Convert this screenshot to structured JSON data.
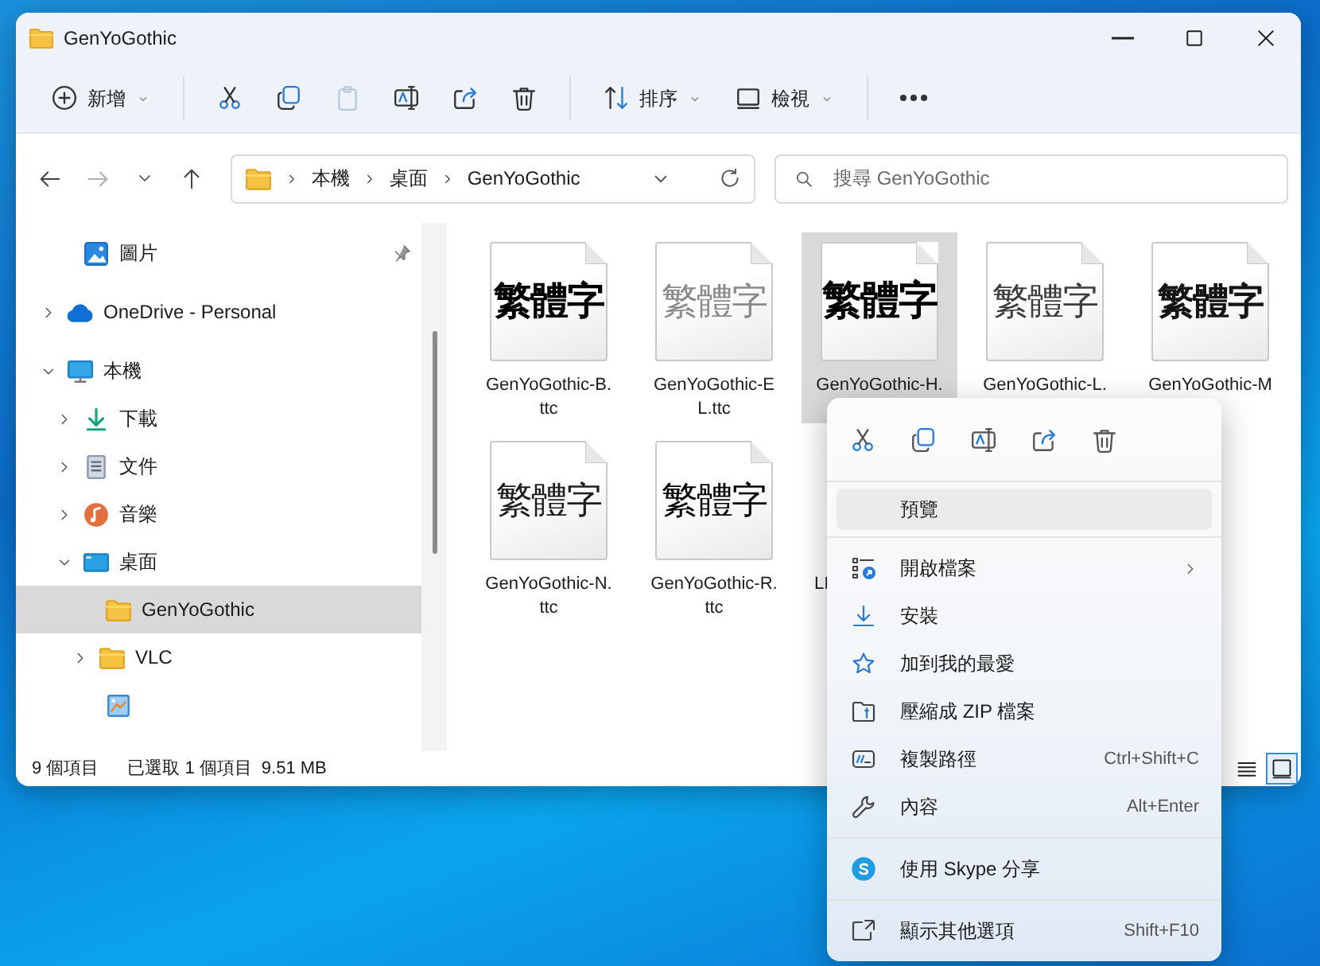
{
  "window": {
    "title": "GenYoGothic"
  },
  "command_bar": {
    "groups": [
      {
        "items": [
          {
            "kind": "new",
            "label": "新增",
            "dropdown": true,
            "disabled": false
          }
        ]
      },
      {
        "items": [
          {
            "kind": "cut",
            "dropdown": false,
            "disabled": false
          },
          {
            "kind": "copy",
            "dropdown": false,
            "disabled": false
          },
          {
            "kind": "paste",
            "dropdown": false,
            "disabled": true
          },
          {
            "kind": "rename",
            "dropdown": false,
            "disabled": false
          },
          {
            "kind": "share",
            "dropdown": false,
            "disabled": false
          },
          {
            "kind": "delete",
            "dropdown": false,
            "disabled": false
          }
        ]
      },
      {
        "items": [
          {
            "kind": "sort",
            "label": "排序",
            "dropdown": true,
            "disabled": false
          },
          {
            "kind": "view",
            "label": "檢視",
            "dropdown": true,
            "disabled": false
          }
        ]
      },
      {
        "items": [
          {
            "kind": "more",
            "dropdown": false,
            "disabled": false
          }
        ]
      }
    ]
  },
  "navigation": {
    "buttons": [
      {
        "kind": "back",
        "disabled": false
      },
      {
        "kind": "forward",
        "disabled": true
      },
      {
        "kind": "recent",
        "disabled": false
      },
      {
        "kind": "up",
        "disabled": false
      }
    ]
  },
  "address_bar": {
    "segments": [
      "本機",
      "桌面",
      "GenYoGothic"
    ]
  },
  "search": {
    "placeholder": "搜尋 GenYoGothic"
  },
  "sidebar": {
    "items": [
      {
        "kind": "pictures",
        "label": "圖片",
        "pinned": true,
        "selected": false
      },
      {
        "kind": "cloud",
        "label": "OneDrive - Personal",
        "pinned": false,
        "expanded": false,
        "selected": false
      },
      {
        "kind": "pc",
        "label": "本機",
        "pinned": false,
        "expanded": true,
        "selected": false,
        "children": [
          {
            "kind": "download",
            "label": "下載",
            "expanded": false,
            "selected": false
          },
          {
            "kind": "documents",
            "label": "文件",
            "expanded": false,
            "selected": false
          },
          {
            "kind": "music",
            "label": "音樂",
            "expanded": false,
            "selected": false
          },
          {
            "kind": "desktop",
            "label": "桌面",
            "expanded": true,
            "selected": false,
            "children": [
              {
                "kind": "folder",
                "label": "GenYoGothic",
                "selected": true
              },
              {
                "kind": "folder",
                "label": "VLC",
                "expanded": false,
                "selected": false
              },
              {
                "kind": "app",
                "selected": false
              }
            ]
          }
        ]
      }
    ]
  },
  "files": [
    {
      "name": "GenYoGothic-B.ttc",
      "preview_text": "繁體字",
      "kind": "bold",
      "selected": false
    },
    {
      "name": "GenYoGothic-EL.ttc",
      "preview_text": "繁體字",
      "kind": "extralight",
      "selected": false
    },
    {
      "name": "GenYoGothic-H.",
      "preview_text": "繁體字",
      "kind": "heavy",
      "selected": true
    },
    {
      "name": "GenYoGothic-L.",
      "preview_text": "繁體字",
      "kind": "light",
      "selected": false
    },
    {
      "name": "GenYoGothic-M",
      "preview_text": "繁體字",
      "kind": "medium",
      "selected": false
    },
    {
      "name": "GenYoGothic-N.ttc",
      "preview_text": "繁體字",
      "kind": "normal",
      "selected": false
    },
    {
      "name": "GenYoGothic-R.ttc",
      "preview_text": "繁體字",
      "kind": "regular",
      "selected": false
    },
    {
      "name": "LI",
      "kind": "other"
    }
  ],
  "status_bar": {
    "item_count": "9 個項目",
    "selection": "已選取 1 個項目",
    "size": "9.51 MB"
  },
  "view_buttons": [
    {
      "kind": "details",
      "selected": false
    },
    {
      "kind": "large_icons",
      "selected": true
    }
  ],
  "context_menu": {
    "quick_actions": [
      {
        "kind": "cut"
      },
      {
        "kind": "copy"
      },
      {
        "kind": "rename"
      },
      {
        "kind": "share"
      },
      {
        "kind": "delete"
      }
    ],
    "groups": [
      {
        "items": [
          {
            "label": "預覽",
            "highlighted": true,
            "submenu": false
          }
        ]
      },
      {
        "items": [
          {
            "kind": "open",
            "label": "開啟檔案",
            "highlighted": false,
            "submenu": true
          },
          {
            "kind": "install",
            "label": "安裝",
            "highlighted": false,
            "submenu": false
          },
          {
            "kind": "star",
            "label": "加到我的最愛",
            "highlighted": false,
            "submenu": false
          },
          {
            "kind": "zip",
            "label": "壓縮成 ZIP 檔案",
            "highlighted": false,
            "submenu": false
          },
          {
            "kind": "path",
            "label": "複製路徑",
            "shortcut": "Ctrl+Shift+C",
            "highlighted": false,
            "submenu": false
          },
          {
            "kind": "wrench",
            "label": "內容",
            "shortcut": "Alt+Enter",
            "highlighted": false,
            "submenu": false
          }
        ]
      },
      {
        "items": [
          {
            "kind": "skype",
            "label": "使用 Skype 分享",
            "highlighted": false,
            "submenu": false
          }
        ]
      },
      {
        "items": [
          {
            "kind": "more_options",
            "label": "顯示其他選項",
            "shortcut": "Shift+F10",
            "highlighted": false,
            "submenu": false
          }
        ]
      }
    ]
  }
}
